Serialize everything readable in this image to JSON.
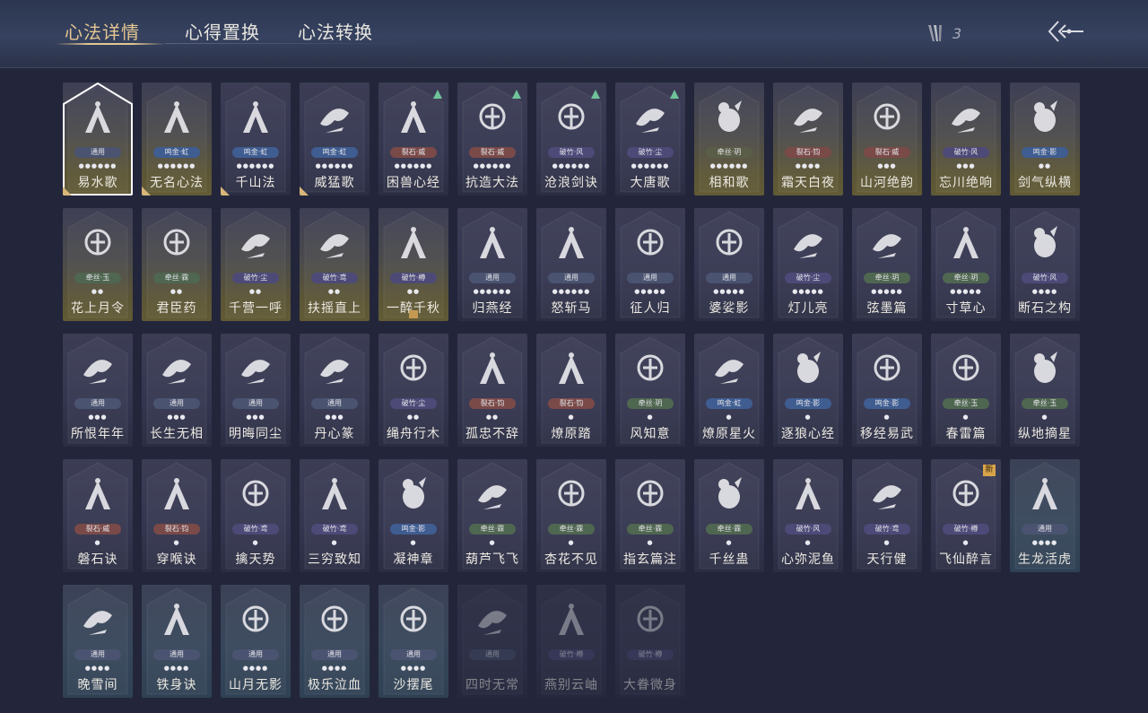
{
  "tabs": [
    {
      "label": "心法详情",
      "active": true
    },
    {
      "label": "心得置换",
      "active": false
    },
    {
      "label": "心法转换",
      "active": false
    }
  ],
  "currency": {
    "icon": "quill-icon",
    "value": "3"
  },
  "back": {
    "icon": "back-arrow-icon"
  },
  "colors": {
    "gold": "#e4c691",
    "up": "#6fc39a",
    "new": "#d7a44a"
  },
  "cards": [
    {
      "name": "易水歌",
      "tag": "通用",
      "tag_color": "#4a5370",
      "dots": "●●●●●●",
      "icon": "horse-icon",
      "theme": "gold",
      "selected": true,
      "corner": true
    },
    {
      "name": "无名心法",
      "tag": "鸣金·虹",
      "tag_color": "#3f5d91",
      "dots": "●●●●●●",
      "icon": "spear-icon",
      "theme": "gold",
      "corner": true
    },
    {
      "name": "千山法",
      "tag": "鸣金·虹",
      "tag_color": "#3f5d91",
      "dots": "●●●●●●",
      "icon": "mountain-icon",
      "theme": "plain",
      "corner": true
    },
    {
      "name": "威猛歌",
      "tag": "鸣金·虹",
      "tag_color": "#3f5d91",
      "dots": "●●●●●●",
      "icon": "fist-icon",
      "theme": "plain",
      "corner": true
    },
    {
      "name": "困兽心经",
      "tag": "裂石·威",
      "tag_color": "#7a4a48",
      "dots": "●●●●●●",
      "icon": "shackle-icon",
      "theme": "plain",
      "up": true
    },
    {
      "name": "抗造大法",
      "tag": "裂石·威",
      "tag_color": "#7a4a48",
      "dots": "●●●●●●",
      "icon": "bell-icon",
      "theme": "plain",
      "up": true
    },
    {
      "name": "沧浪剑诀",
      "tag": "破竹·风",
      "tag_color": "#4d4a78",
      "dots": "●●●●●●",
      "icon": "dragon-icon",
      "theme": "plain",
      "up": true
    },
    {
      "name": "大唐歌",
      "tag": "破竹·尘",
      "tag_color": "#4d4a78",
      "dots": "●●●●●●",
      "icon": "palace-icon",
      "theme": "plain",
      "up": true
    },
    {
      "name": "相和歌",
      "tag": "牵丝·玥",
      "tag_color": "#5a5e48",
      "dots": "●●●●●●",
      "icon": "ram-icon",
      "theme": "gold"
    },
    {
      "name": "霜天白夜",
      "tag": "裂石·钧",
      "tag_color": "#7a4a48",
      "dots": "●●●●",
      "icon": "blade-icon",
      "theme": "gold"
    },
    {
      "name": "山河绝韵",
      "tag": "裂石·威",
      "tag_color": "#7a4a48",
      "dots": "●●●",
      "icon": "landscape-icon",
      "theme": "gold"
    },
    {
      "name": "忘川绝响",
      "tag": "破竹·风",
      "tag_color": "#4d4a78",
      "dots": "●●●",
      "icon": "mask-icon",
      "theme": "gold"
    },
    {
      "name": "剑气纵横",
      "tag": "鸣金·影",
      "tag_color": "#3f5d91",
      "dots": "●●",
      "icon": "swords-icon",
      "theme": "gold"
    },
    {
      "name": "花上月令",
      "tag": "牵丝·玉",
      "tag_color": "#4f6650",
      "dots": "●●",
      "icon": "flower-icon",
      "theme": "gold"
    },
    {
      "name": "君臣药",
      "tag": "牵丝·霖",
      "tag_color": "#4f6650",
      "dots": "●●",
      "icon": "gourd-icon",
      "theme": "gold"
    },
    {
      "name": "千营一呼",
      "tag": "破竹·尘",
      "tag_color": "#4d4a78",
      "dots": "●●",
      "icon": "flag-icon",
      "theme": "gold"
    },
    {
      "name": "扶摇直上",
      "tag": "破竹·鸢",
      "tag_color": "#4d4a78",
      "dots": "●●",
      "icon": "eagle-icon",
      "theme": "gold"
    },
    {
      "name": "一醉千秋",
      "tag": "破竹·樽",
      "tag_color": "#4d4a78",
      "dots": "●●",
      "icon": "drinker-icon",
      "theme": "gold",
      "tinybadge": true
    },
    {
      "name": "归燕经",
      "tag": "通用",
      "tag_color": "#4a5370",
      "dots": "●●●●●●",
      "icon": "swallow-icon",
      "theme": "plain"
    },
    {
      "name": "怒斩马",
      "tag": "通用",
      "tag_color": "#4a5370",
      "dots": "●●●●●●",
      "icon": "slash-icon",
      "theme": "plain"
    },
    {
      "name": "征人归",
      "tag": "通用",
      "tag_color": "#4a5370",
      "dots": "●●●●●",
      "icon": "bird-hand-icon",
      "theme": "plain"
    },
    {
      "name": "婆娑影",
      "tag": "通用",
      "tag_color": "#4a5370",
      "dots": "●●●●●",
      "icon": "dragon-icon",
      "theme": "plain"
    },
    {
      "name": "灯儿亮",
      "tag": "破竹·尘",
      "tag_color": "#4d4a78",
      "dots": "●●●●●",
      "icon": "lamp-icon",
      "theme": "plain"
    },
    {
      "name": "弦墨篇",
      "tag": "牵丝·玥",
      "tag_color": "#4f6650",
      "dots": "●●●●●",
      "icon": "zither-icon",
      "theme": "plain"
    },
    {
      "name": "寸草心",
      "tag": "牵丝·玥",
      "tag_color": "#4f6650",
      "dots": "●●●●●",
      "icon": "peach-icon",
      "theme": "plain"
    },
    {
      "name": "断石之构",
      "tag": "破竹·风",
      "tag_color": "#4d4a78",
      "dots": "●●●●",
      "icon": "warrior-icon",
      "theme": "plain"
    },
    {
      "name": "所恨年年",
      "tag": "通用",
      "tag_color": "#4a5370",
      "dots": "●●●",
      "icon": "bamboo-icon",
      "theme": "plain"
    },
    {
      "name": "长生无相",
      "tag": "通用",
      "tag_color": "#4a5370",
      "dots": "●●●",
      "icon": "statue-icon",
      "theme": "plain"
    },
    {
      "name": "明晦同尘",
      "tag": "通用",
      "tag_color": "#4a5370",
      "dots": "●●●",
      "icon": "snake-sword-icon",
      "theme": "plain"
    },
    {
      "name": "丹心篆",
      "tag": "通用",
      "tag_color": "#4a5370",
      "dots": "●●●",
      "icon": "fish-icon",
      "theme": "plain"
    },
    {
      "name": "绳舟行木",
      "tag": "破竹·尘",
      "tag_color": "#4d4a78",
      "dots": "●●",
      "icon": "beast-icon",
      "theme": "plain"
    },
    {
      "name": "孤忠不辞",
      "tag": "裂石·钧",
      "tag_color": "#7a4a48",
      "dots": "●●",
      "icon": "crossed-blades-icon",
      "theme": "plain"
    },
    {
      "name": "燎原踏",
      "tag": "裂石·钧",
      "tag_color": "#7a4a48",
      "dots": "●",
      "icon": "horse-icon",
      "theme": "plain"
    },
    {
      "name": "风知意",
      "tag": "牵丝·玥",
      "tag_color": "#4f6650",
      "dots": "●",
      "icon": "fan-icon",
      "theme": "plain"
    },
    {
      "name": "燎原星火",
      "tag": "鸣金·虹",
      "tag_color": "#3f5d91",
      "dots": "●",
      "icon": "scythe-icon",
      "theme": "plain"
    },
    {
      "name": "逐狼心经",
      "tag": "鸣金·影",
      "tag_color": "#3f5d91",
      "dots": "●",
      "icon": "wolf-icon",
      "theme": "plain"
    },
    {
      "name": "移经易武",
      "tag": "鸣金·影",
      "tag_color": "#3f5d91",
      "dots": "●",
      "icon": "armor-icon",
      "theme": "plain"
    },
    {
      "name": "春雷篇",
      "tag": "牵丝·玉",
      "tag_color": "#4f6650",
      "dots": "●",
      "icon": "thunder-tree-icon",
      "theme": "plain"
    },
    {
      "name": "纵地摘星",
      "tag": "牵丝·玉",
      "tag_color": "#4f6650",
      "dots": "●",
      "icon": "moon-warrior-icon",
      "theme": "plain"
    },
    {
      "name": "磐石诀",
      "tag": "裂石·威",
      "tag_color": "#7a4a48",
      "dots": "●",
      "icon": "rock-icon",
      "theme": "plain"
    },
    {
      "name": "穿喉诀",
      "tag": "裂石·钧",
      "tag_color": "#7a4a48",
      "dots": "●",
      "icon": "wave-icon",
      "theme": "plain"
    },
    {
      "name": "擒天势",
      "tag": "破竹·鸢",
      "tag_color": "#4d4a78",
      "dots": "●",
      "icon": "chain-flower-icon",
      "theme": "plain"
    },
    {
      "name": "三穷致知",
      "tag": "破竹·鸢",
      "tag_color": "#4d4a78",
      "dots": "●",
      "icon": "scroll-icon",
      "theme": "plain"
    },
    {
      "name": "凝神章",
      "tag": "鸣金·影",
      "tag_color": "#3f5d91",
      "dots": "●",
      "icon": "bow-icon",
      "theme": "plain"
    },
    {
      "name": "葫芦飞飞",
      "tag": "牵丝·霖",
      "tag_color": "#4f6650",
      "dots": "●",
      "icon": "gourd-pair-icon",
      "theme": "plain"
    },
    {
      "name": "杏花不见",
      "tag": "牵丝·霖",
      "tag_color": "#4f6650",
      "dots": "●",
      "icon": "blossom-icon",
      "theme": "plain"
    },
    {
      "name": "指玄篇注",
      "tag": "牵丝·霖",
      "tag_color": "#4f6650",
      "dots": "●",
      "icon": "yinyang-icon",
      "theme": "plain"
    },
    {
      "name": "千丝蛊",
      "tag": "牵丝·霖",
      "tag_color": "#4f6650",
      "dots": "●",
      "icon": "leaf-icon",
      "theme": "plain"
    },
    {
      "name": "心弥泥鱼",
      "tag": "破竹·风",
      "tag_color": "#4d4a78",
      "dots": "●",
      "icon": "fish-school-icon",
      "theme": "plain"
    },
    {
      "name": "天行健",
      "tag": "破竹·鸢",
      "tag_color": "#4d4a78",
      "dots": "●",
      "icon": "umbrella-icon",
      "theme": "plain"
    },
    {
      "name": "飞仙醉言",
      "tag": "破竹·樽",
      "tag_color": "#4d4a78",
      "dots": "●",
      "icon": "wine-jar-icon",
      "theme": "plain",
      "newtag": "新"
    },
    {
      "name": "生龙活虎",
      "tag": "通用",
      "tag_color": "#4a5370",
      "dots": "●●●●",
      "icon": "tiger-swirl-icon",
      "theme": "teal"
    },
    {
      "name": "晚雪间",
      "tag": "通用",
      "tag_color": "#4a5370",
      "dots": "●●●●",
      "icon": "cross-icon",
      "theme": "teal"
    },
    {
      "name": "铁身诀",
      "tag": "通用",
      "tag_color": "#4a5370",
      "dots": "●●●●",
      "icon": "muscle-icon",
      "theme": "teal"
    },
    {
      "name": "山月无影",
      "tag": "通用",
      "tag_color": "#4a5370",
      "dots": "●●●●",
      "icon": "claw-icon",
      "theme": "teal"
    },
    {
      "name": "极乐泣血",
      "tag": "通用",
      "tag_color": "#4a5370",
      "dots": "●●●●",
      "icon": "sickle-icon",
      "theme": "teal"
    },
    {
      "name": "沙摆尾",
      "tag": "通用",
      "tag_color": "#4a5370",
      "dots": "●●●●",
      "icon": "swirl-icon",
      "theme": "teal"
    },
    {
      "name": "四时无常",
      "tag": "通用",
      "tag_color": "#4a5370",
      "dots": "",
      "icon": "figure-icon",
      "theme": "faded"
    },
    {
      "name": "燕别云岫",
      "tag": "破竹·樽",
      "tag_color": "#4d4a78",
      "dots": "",
      "icon": "swallow-icon",
      "theme": "faded"
    },
    {
      "name": "大眷微身",
      "tag": "破竹·樽",
      "tag_color": "#4d4a78",
      "dots": "",
      "icon": "serpent-icon",
      "theme": "faded"
    }
  ]
}
